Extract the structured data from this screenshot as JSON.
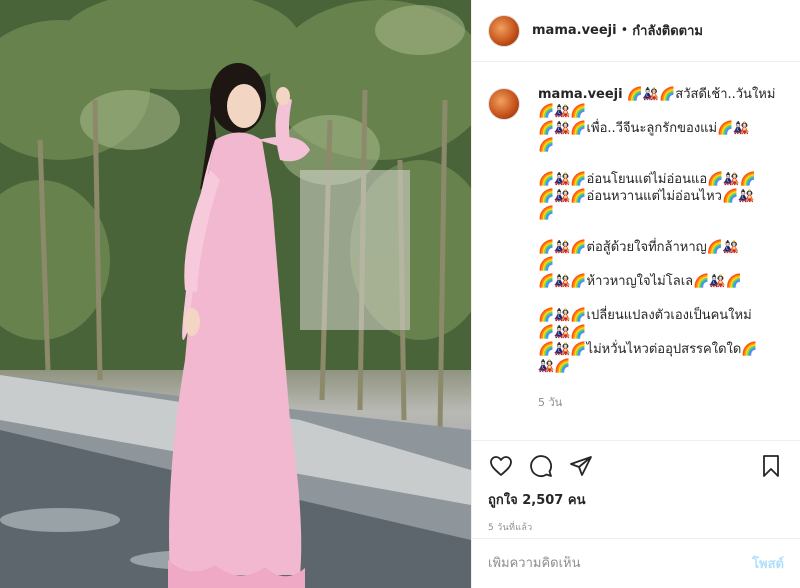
{
  "post": {
    "image_alt": "",
    "header": {
      "username": "mama.veeji",
      "separator": "•",
      "follow_status": "กำลังติดตาม"
    },
    "caption": {
      "username": "mama.veeji",
      "lines": [
        "🌈🎎🌈สวัสดีเช้า..วันใหม่",
        "🌈🎎🌈",
        "🌈🎎🌈เพื่อ..วีจีนะลูกรักของแม่🌈🎎",
        "🌈",
        "",
        "🌈🎎🌈อ่อนโยนแต่ไม่อ่อนแอ🌈🎎🌈",
        "🌈🎎🌈อ่อนหวานแต่ไม่อ่อนไหว🌈🎎",
        "🌈",
        "",
        "🌈🎎🌈ต่อสู้ด้วยใจที่กล้าหาญ🌈🎎",
        "🌈",
        "🌈🎎🌈ห้าวหาญใจไม่โลเล🌈🎎🌈",
        "",
        "🌈🎎🌈เปลี่ยนแปลงตัวเองเป็นคนใหม่",
        "🌈🎎🌈",
        "🌈🎎🌈ไม่หวั่นไหวต่ออุปสรรคใดใด🌈",
        "🎎🌈"
      ],
      "time_ago": "5 วัน"
    },
    "icons": {
      "like": "heart-icon",
      "comment": "comment-icon",
      "share": "share-icon",
      "save": "bookmark-icon"
    },
    "likes_text": "ถูกใจ 2,507 คน",
    "date_text": "5 วันที่แล้ว",
    "comment": {
      "placeholder": "เพิ่มความคิดเห็น",
      "value": "",
      "post_label": "โพสต์"
    },
    "colors": {
      "accent_disabled": "#b2dffc",
      "muted": "#8e8e8e",
      "text": "#262626"
    }
  }
}
